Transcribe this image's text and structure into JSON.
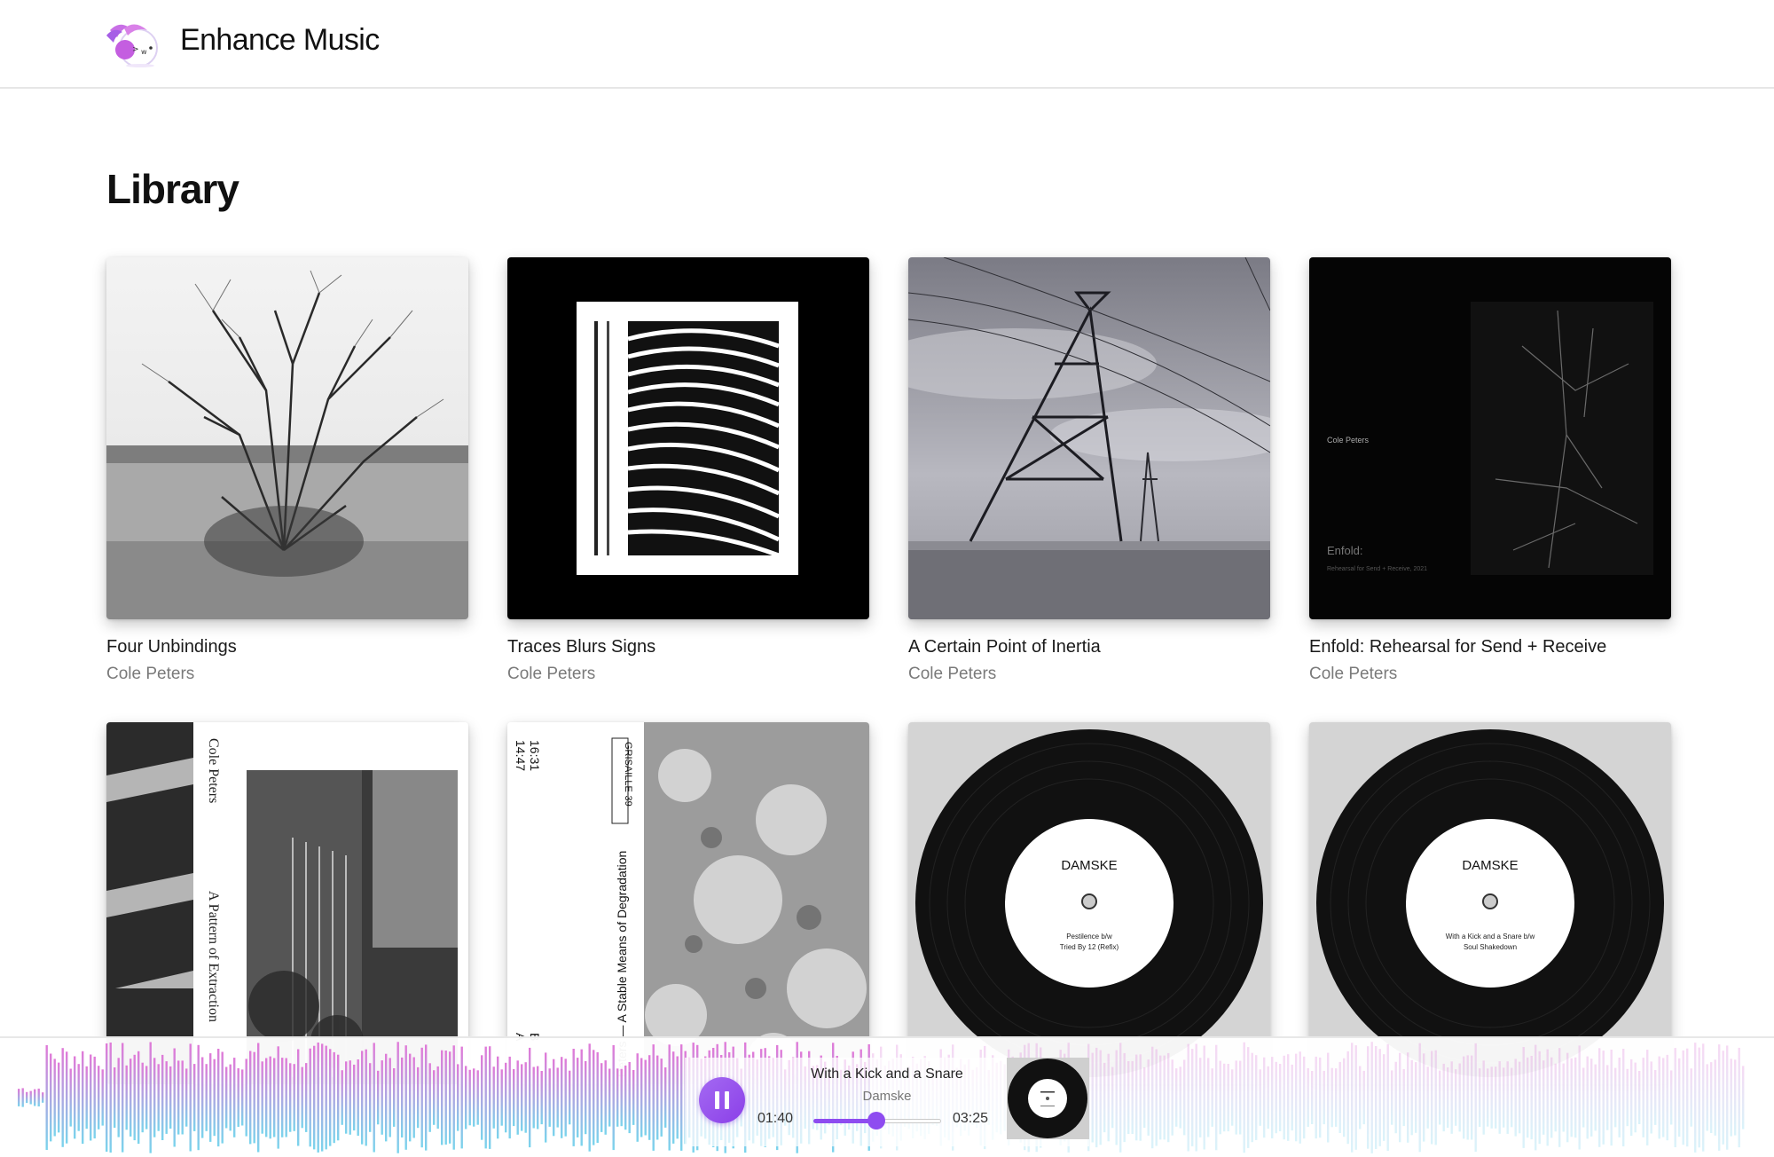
{
  "app": {
    "title": "Enhance Music",
    "logo_icon": "bird-mascot-icon"
  },
  "library": {
    "heading": "Library",
    "albums": [
      {
        "title": "Four Unbindings",
        "artist": "Cole Peters"
      },
      {
        "title": "Traces Blurs Signs",
        "artist": "Cole Peters"
      },
      {
        "title": "A Certain Point of Inertia",
        "artist": "Cole Peters"
      },
      {
        "title": "Enfold: Rehearsal for Send + Receive",
        "artist": "Cole Peters",
        "cover_text": {
          "artist": "Cole Peters",
          "title": "Enfold:",
          "subtitle": "Rehearsal for Send + Receive, 2021"
        }
      },
      {
        "title": "",
        "artist": "",
        "cover_text": {
          "artist": "Cole Peters",
          "title": "A Pattern of Extraction"
        }
      },
      {
        "title": "",
        "artist": "",
        "cover_text": {
          "times": [
            "14:47",
            "16:31"
          ],
          "sides": [
            "A",
            "B"
          ],
          "label": "GRISAILLE-39",
          "spine": "Peters — A Stable Means of Degradation"
        }
      },
      {
        "title": "",
        "artist": "",
        "cover_text": {
          "label": "DAMSKE",
          "tracks": [
            "Pestilence b/w",
            "Tried By 12 (Refix)"
          ]
        }
      },
      {
        "title": "",
        "artist": "",
        "cover_text": {
          "label": "DAMSKE",
          "tracks": [
            "With a Kick and a Snare b/w",
            "Soul Shakedown"
          ]
        }
      }
    ]
  },
  "player": {
    "track_title": "With a Kick and a Snare",
    "track_artist": "Damske",
    "current_time": "01:40",
    "total_time": "03:25",
    "progress": 0.49,
    "state": "playing",
    "button_icon": "pause-icon",
    "accent": "#8e4cf0",
    "waveform_colors": [
      "#e07ad8",
      "#7ad4ec"
    ]
  }
}
